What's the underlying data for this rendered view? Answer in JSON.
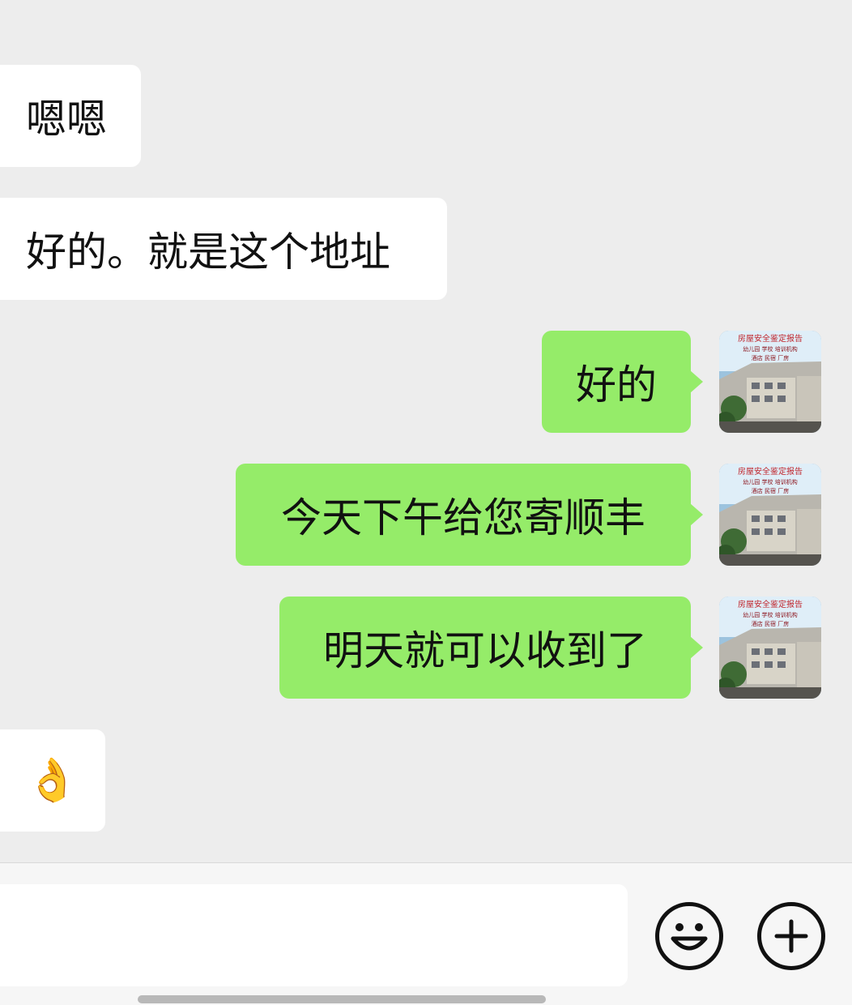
{
  "messages": [
    {
      "side": "in",
      "text": "嗯嗯"
    },
    {
      "side": "in",
      "text": "好的。就是这个地址"
    },
    {
      "side": "out",
      "text": "好的"
    },
    {
      "side": "out",
      "text": "今天下午给您寄顺丰"
    },
    {
      "side": "out",
      "text": "明天就可以收到了"
    },
    {
      "side": "in",
      "text": "👌"
    }
  ],
  "avatar": {
    "caption_line1": "房屋安全鉴定报告",
    "caption_line2": "幼儿园 学校 培训机构",
    "caption_line3": "酒店 民宿 厂房"
  },
  "input_bar": {
    "placeholder": "",
    "emoji_button_icon": "smiley-icon",
    "more_button_icon": "plus-circle-icon"
  },
  "colors": {
    "background": "#ededed",
    "incoming_bubble": "#ffffff",
    "outgoing_bubble": "#95ec69"
  }
}
